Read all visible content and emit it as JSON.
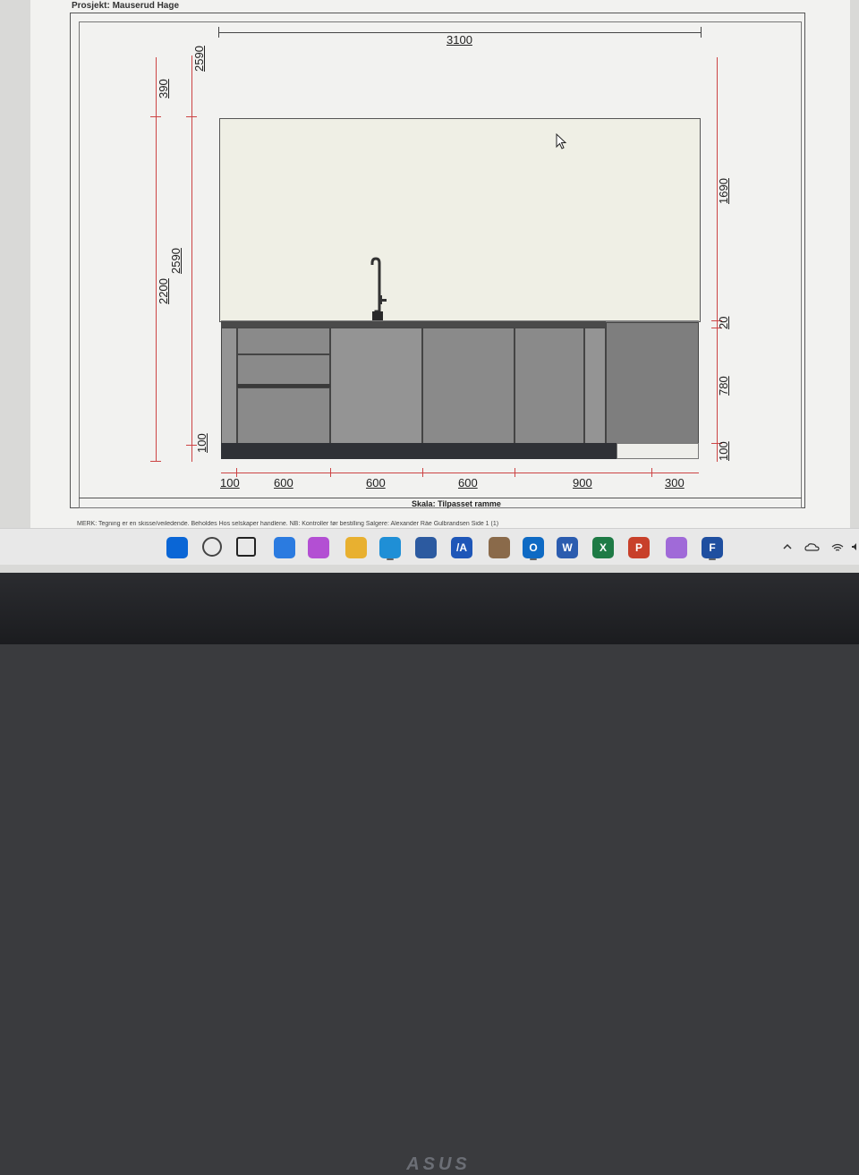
{
  "document": {
    "project_label": "Prosjekt: Mauserud Hage",
    "scale_label": "Skala: Tilpasset ramme",
    "footer_text": "MERK: Tegning er en skisse/veiledende. Beholdes Hos selskaper handlene. NB: Kontroller før bestilling     Salgere: Alexander Råe Gulbrandsen     Side 1 (1)"
  },
  "drawing": {
    "top_dimension": "3100",
    "left_dims": [
      "390",
      "2200",
      "2590",
      "2590",
      "100"
    ],
    "right_dims": [
      "1690",
      "20",
      "780",
      "100"
    ],
    "bottom_dims": [
      "100",
      "600",
      "600",
      "600",
      "900",
      "300"
    ]
  },
  "taskbar": {
    "icons": [
      {
        "name": "start-icon",
        "label": "",
        "color": "#0a66d6"
      },
      {
        "name": "search-icon",
        "label": "",
        "color": "#444"
      },
      {
        "name": "task-view-icon",
        "label": "",
        "color": "#222"
      },
      {
        "name": "copilot-icon",
        "label": "",
        "color": "#2b7be0"
      },
      {
        "name": "copilot-app-icon",
        "label": "",
        "color": "#b34fd3"
      },
      {
        "name": "file-explorer-icon",
        "label": "",
        "color": "#e8b030"
      },
      {
        "name": "edge-icon",
        "label": "",
        "color": "#1f8fd6"
      },
      {
        "name": "store-icon",
        "label": "",
        "color": "#2c5aa0"
      },
      {
        "name": "autocad-icon",
        "label": "/A",
        "color": "#1e56b8"
      },
      {
        "name": "sketchup-icon",
        "label": "",
        "color": "#8a6a4a"
      },
      {
        "name": "outlook-icon",
        "label": "O",
        "color": "#0e6ac4"
      },
      {
        "name": "word-icon",
        "label": "W",
        "color": "#2b5caf"
      },
      {
        "name": "excel-icon",
        "label": "X",
        "color": "#1e7a45"
      },
      {
        "name": "powerpoint-icon",
        "label": "P",
        "color": "#c8402a"
      },
      {
        "name": "snipping-tool-icon",
        "label": "",
        "color": "#a06ad8"
      },
      {
        "name": "app-f-icon",
        "label": "F",
        "color": "#1f4fa0"
      }
    ],
    "tray": [
      "chevron-up-icon",
      "onedrive-icon",
      "wifi-icon",
      "volume-icon"
    ]
  },
  "bezel": {
    "brand": "ASUS"
  }
}
